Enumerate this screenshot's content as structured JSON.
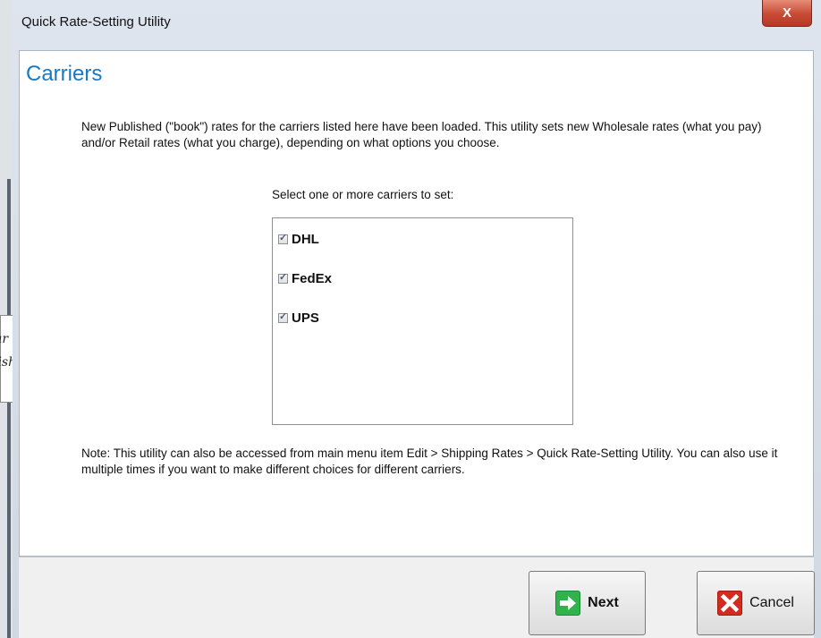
{
  "background": {
    "note_line1": "ar",
    "note_line2": "ublished"
  },
  "window": {
    "title": "Quick Rate-Setting Utility",
    "close_label": "X"
  },
  "page": {
    "heading": "Carriers",
    "intro": "New Published (\"book\") rates for the carriers listed here have been loaded. This utility sets new Wholesale rates (what you pay) and/or Retail rates (what you charge), depending on what options you choose.",
    "select_label": "Select one or more carriers to set:",
    "carriers": [
      {
        "label": "DHL",
        "checked": true
      },
      {
        "label": "FedEx",
        "checked": true
      },
      {
        "label": "UPS",
        "checked": true
      }
    ],
    "note": "Note: This utility can also be accessed from main menu item Edit > Shipping Rates > Quick Rate-Setting Utility. You can also use it multiple times if you want to make different choices for different carriers."
  },
  "buttons": {
    "next_label": "Next",
    "cancel_label": "Cancel"
  },
  "colors": {
    "heading": "#1b79c4",
    "close_button": "#c64a34",
    "next_icon": "#2fb34a",
    "cancel_icon": "#d42b1f"
  }
}
